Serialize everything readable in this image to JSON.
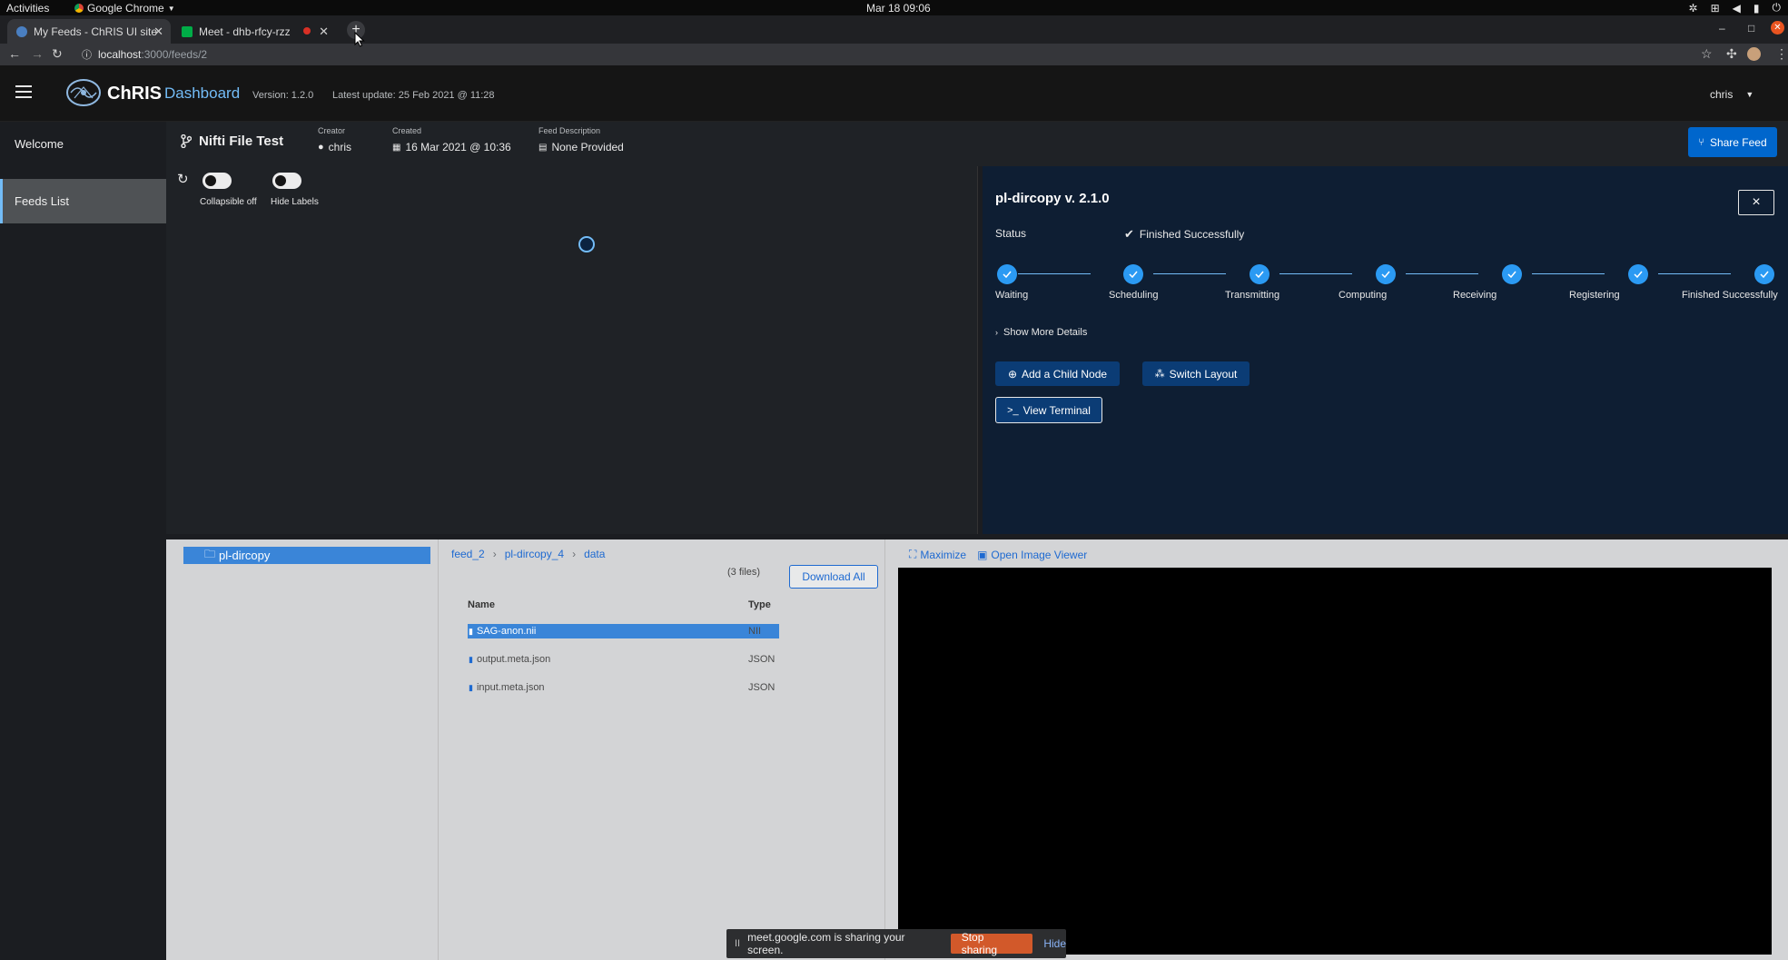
{
  "os": {
    "activities": "Activities",
    "app_menu": "Google Chrome",
    "clock": "Mar 18  09:06"
  },
  "browser": {
    "tabs": [
      {
        "title": "My Feeds - ChRIS UI site",
        "active": true
      },
      {
        "title": "Meet - dhb-rfcy-rzz",
        "active": false
      }
    ],
    "new_tab_label": "+",
    "url_host": "localhost",
    "url_path": ":3000/feeds/2"
  },
  "app": {
    "brand": "ChRIS",
    "brand_sub": "Dashboard",
    "version": "Version: 1.2.0",
    "latest_update": "Latest update: 25 Feb 2021 @ 11:28",
    "user": "chris"
  },
  "sidebar": {
    "items": [
      {
        "label": "Welcome",
        "active": false
      },
      {
        "label": "Feeds List",
        "active": true
      }
    ]
  },
  "feed": {
    "title": "Nifti File Test",
    "creator_label": "Creator",
    "creator": "chris",
    "created_label": "Created",
    "created": "16 Mar 2021 @ 10:36",
    "description_label": "Feed Description",
    "description": "None Provided",
    "share_button": "Share Feed"
  },
  "graph": {
    "toggle1_label": "Collapsible off",
    "toggle2_label": "Hide Labels"
  },
  "node_panel": {
    "title": "pl-dircopy v. 2.1.0",
    "close_label": "×",
    "status_label": "Status",
    "status_value": "Finished Successfully",
    "steps": [
      "Waiting",
      "Scheduling",
      "Transmitting",
      "Computing",
      "Receiving",
      "Registering",
      "Finished Successfully"
    ],
    "show_more": "Show More Details",
    "add_child_button": "Add a Child Node",
    "switch_layout_button": "Switch Layout",
    "view_terminal_button": "View Terminal"
  },
  "file_browser": {
    "tree_item": "pl-dircopy",
    "breadcrumbs": [
      "feed_2",
      "pl-dircopy_4",
      "data"
    ],
    "file_count": "(3 files)",
    "download_all": "Download All",
    "columns": {
      "name": "Name",
      "type": "Type"
    },
    "files": [
      {
        "name": "SAG-anon.nii",
        "type": "NII",
        "selected": true
      },
      {
        "name": "output.meta.json",
        "type": "JSON",
        "selected": false
      },
      {
        "name": "input.meta.json",
        "type": "JSON",
        "selected": false
      }
    ],
    "maximize": "Maximize",
    "open_viewer": "Open Image Viewer"
  },
  "share_notice": {
    "text": "meet.google.com is sharing your screen.",
    "stop": "Stop sharing",
    "hide": "Hide"
  },
  "colors": {
    "accent": "#0066cc",
    "step": "#2b9af3",
    "panel_bg": "#0e1e33",
    "stop_sharing": "#d2592a"
  }
}
